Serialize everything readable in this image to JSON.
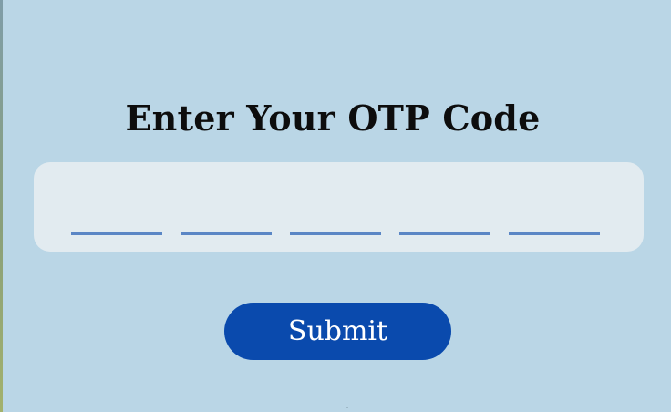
{
  "page": {
    "title": "Enter Your OTP Code",
    "background_color": "#bad6e6"
  },
  "otp": {
    "card_color": "#e2ebf0",
    "underline_color": "#5a86c5",
    "digits": [
      {
        "value": "",
        "placeholder": ""
      },
      {
        "value": "",
        "placeholder": ""
      },
      {
        "value": "",
        "placeholder": ""
      },
      {
        "value": "",
        "placeholder": ""
      },
      {
        "value": "",
        "placeholder": ""
      }
    ]
  },
  "submit": {
    "label": "Submit",
    "color": "#0a4aad"
  }
}
